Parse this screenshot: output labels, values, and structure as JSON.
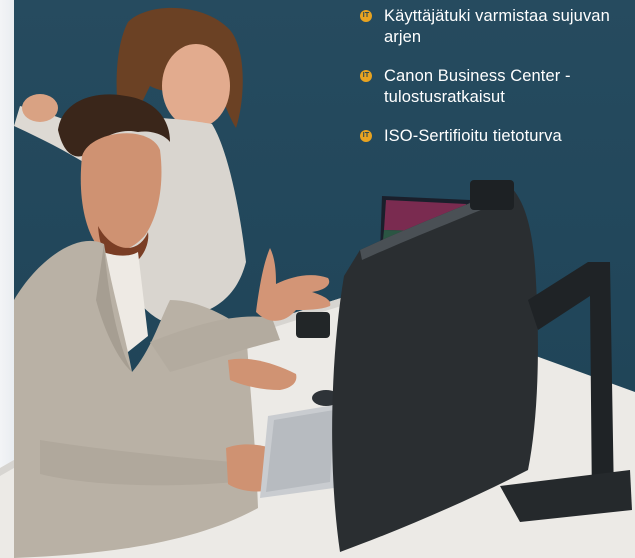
{
  "features": [
    {
      "icon": "it-badge-icon",
      "text": "Käyttäjätuki varmistaa sujuvan arjen"
    },
    {
      "icon": "it-badge-icon",
      "text": "Canon Business Center -tulostusratkaisut"
    },
    {
      "icon": "it-badge-icon",
      "text": "ISO-Sertifioitu tietoturva"
    }
  ],
  "badge_glyph": "IT",
  "colors": {
    "background": "#22475b",
    "accent": "#e7a321",
    "text": "#ffffff"
  }
}
